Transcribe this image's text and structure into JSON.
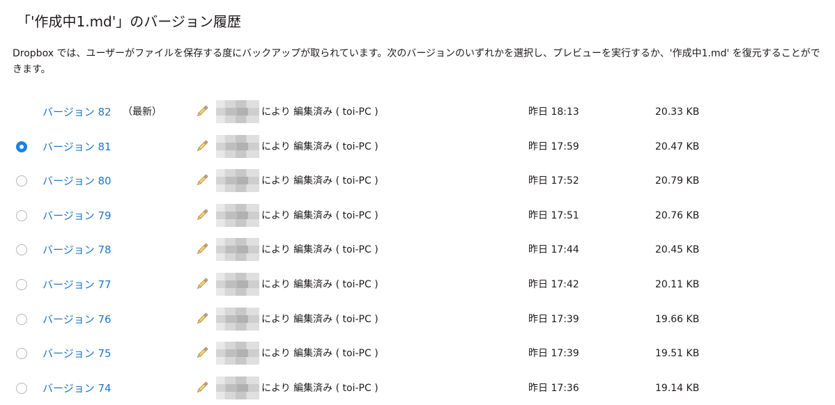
{
  "header": {
    "title": "「'作成中1.md'」のバージョン履歴"
  },
  "description": {
    "text": "Dropbox では、ユーザーがファイルを保存する度にバックアップが取られています。次のバージョンのいずれかを選択し、プレビューを実行するか、'作成中1.md' を復元することができます。"
  },
  "versions": [
    {
      "label": "バージョン 82",
      "latest_tag": "（最新）",
      "edit_info": "により 編集済み ( toi-PC )",
      "timestamp": "昨日 18:13",
      "size": "20.33 KB",
      "selectable": false,
      "selected": false
    },
    {
      "label": "バージョン 81",
      "latest_tag": "",
      "edit_info": "により 編集済み ( toi-PC )",
      "timestamp": "昨日 17:59",
      "size": "20.47 KB",
      "selectable": true,
      "selected": true
    },
    {
      "label": "バージョン 80",
      "latest_tag": "",
      "edit_info": "により 編集済み ( toi-PC )",
      "timestamp": "昨日 17:52",
      "size": "20.79 KB",
      "selectable": true,
      "selected": false
    },
    {
      "label": "バージョン 79",
      "latest_tag": "",
      "edit_info": "により 編集済み ( toi-PC )",
      "timestamp": "昨日 17:51",
      "size": "20.76 KB",
      "selectable": true,
      "selected": false
    },
    {
      "label": "バージョン 78",
      "latest_tag": "",
      "edit_info": "により 編集済み ( toi-PC )",
      "timestamp": "昨日 17:44",
      "size": "20.45 KB",
      "selectable": true,
      "selected": false
    },
    {
      "label": "バージョン 77",
      "latest_tag": "",
      "edit_info": "により 編集済み ( toi-PC )",
      "timestamp": "昨日 17:42",
      "size": "20.11 KB",
      "selectable": true,
      "selected": false
    },
    {
      "label": "バージョン 76",
      "latest_tag": "",
      "edit_info": "により 編集済み ( toi-PC )",
      "timestamp": "昨日 17:39",
      "size": "19.66 KB",
      "selectable": true,
      "selected": false
    },
    {
      "label": "バージョン 75",
      "latest_tag": "",
      "edit_info": "により 編集済み ( toi-PC )",
      "timestamp": "昨日 17:39",
      "size": "19.51 KB",
      "selectable": true,
      "selected": false
    },
    {
      "label": "バージョン 74",
      "latest_tag": "",
      "edit_info": "により 編集済み ( toi-PC )",
      "timestamp": "昨日 17:36",
      "size": "19.14 KB",
      "selectable": true,
      "selected": false
    }
  ],
  "icons": {
    "edit": "pencil-icon",
    "editor_avatar": "blurred-name"
  },
  "colors": {
    "link": "#1f74c8",
    "radio_selected": "#1a82e2",
    "text": "#1e1919"
  }
}
